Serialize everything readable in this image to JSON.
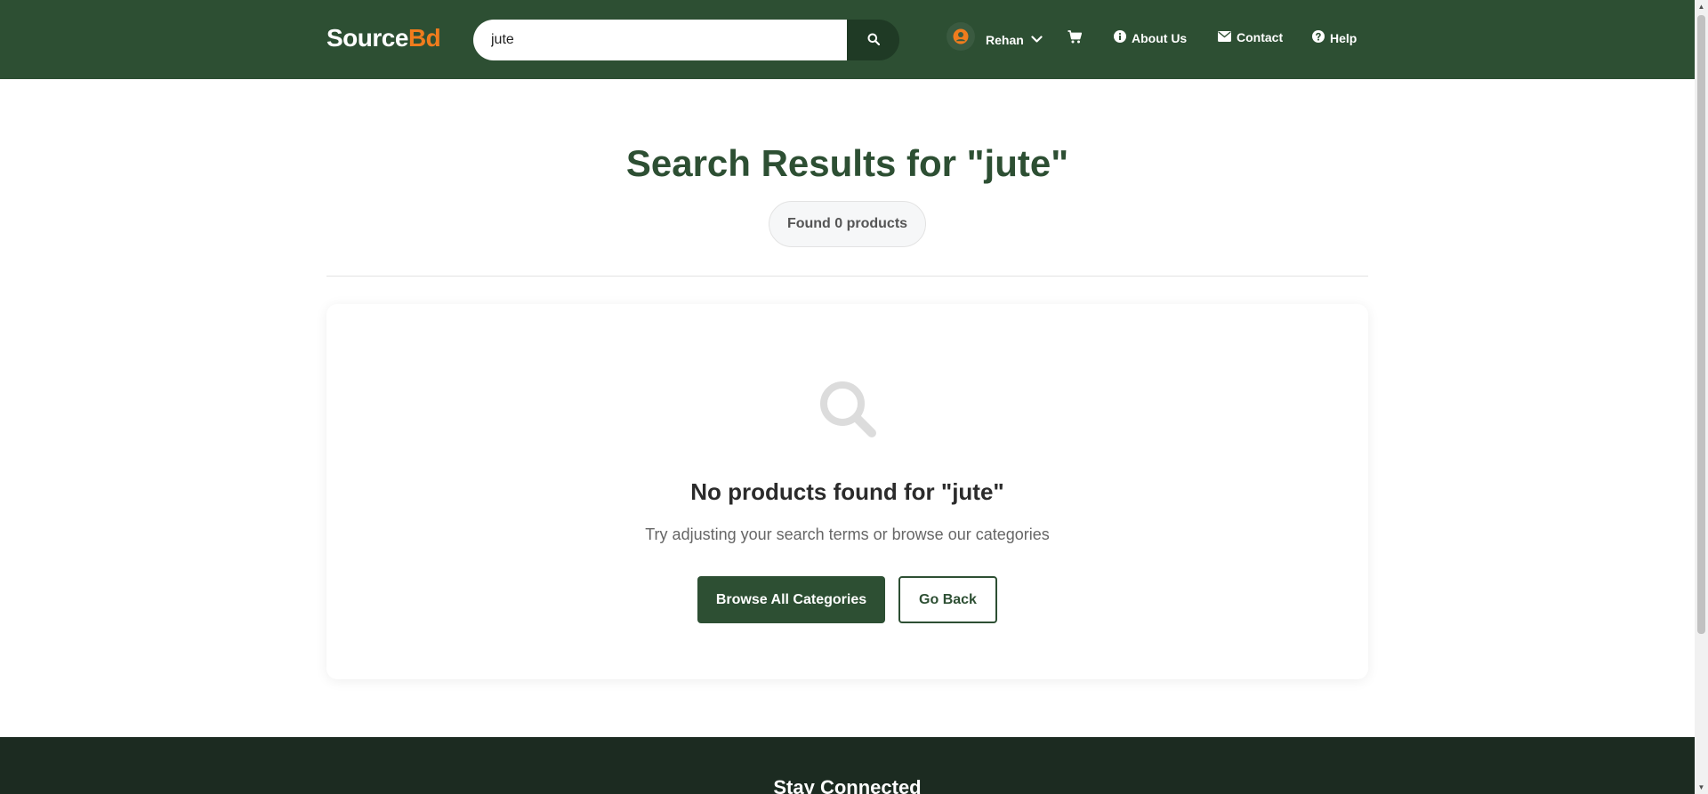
{
  "header": {
    "logo_source": "Source",
    "logo_bd": "Bd",
    "search_value": "jute",
    "user_name": "Rehan",
    "nav": {
      "about": "About Us",
      "contact": "Contact",
      "help": "Help"
    }
  },
  "main": {
    "title": "Search Results for \"jute\"",
    "found_badge": "Found 0 products",
    "empty_title": "No products found for \"jute\"",
    "empty_subtitle": "Try adjusting your search terms or browse our categories",
    "browse_button": "Browse All Categories",
    "back_button": "Go Back"
  },
  "footer": {
    "title": "Stay Connected"
  },
  "colors": {
    "brand_green": "#2d4f33",
    "accent_orange": "#f07c1d",
    "footer_dark": "#1c2b21"
  },
  "icons": {
    "search_button": "search-icon",
    "user": "user-circle-icon",
    "dropdown": "chevron-down-icon",
    "cart": "cart-icon",
    "about": "info-circle-icon",
    "contact": "envelope-icon",
    "help": "question-circle-icon",
    "empty_state": "magnifier-icon"
  }
}
